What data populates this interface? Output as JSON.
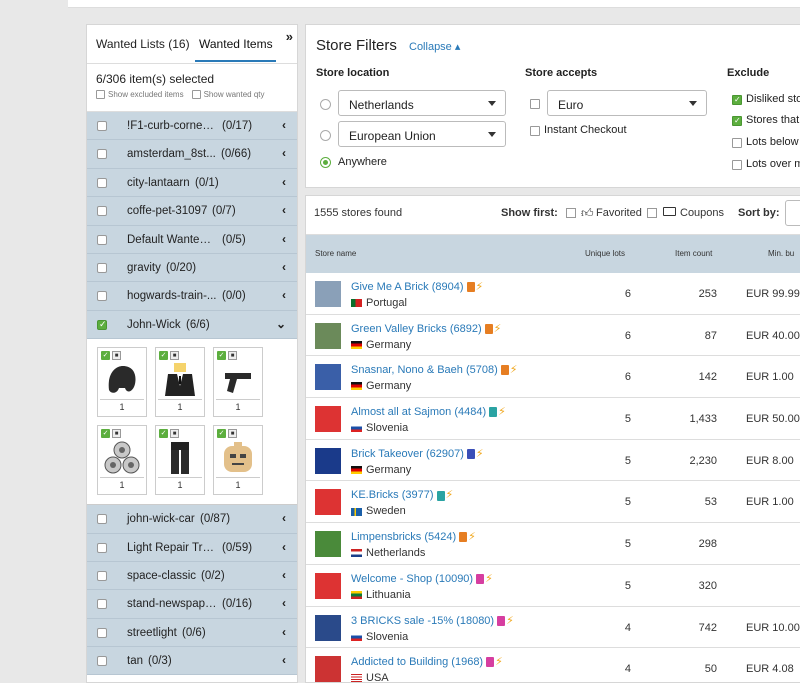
{
  "left_panel": {
    "tab_wanted_lists": "Wanted Lists (16)",
    "tab_wanted_items": "Wanted Items",
    "selected_info": "6/306 item(s) selected",
    "show_excluded": "Show excluded items",
    "show_wanted_qty": "Show wanted qty",
    "lists_top": [
      {
        "name": "!F1-curb-corner-1...",
        "count": "(0/17)",
        "checked": false
      },
      {
        "name": "amsterdam_8st...",
        "count": "(0/66)",
        "checked": false
      },
      {
        "name": "city-lantaarn",
        "count": "(0/1)",
        "checked": false
      },
      {
        "name": "coffe-pet-31097",
        "count": "(0/7)",
        "checked": false
      },
      {
        "name": "Default Wanted ...",
        "count": "(0/5)",
        "checked": false
      },
      {
        "name": "gravity",
        "count": "(0/20)",
        "checked": false
      },
      {
        "name": "hogwards-train-...",
        "count": "(0/0)",
        "checked": false
      },
      {
        "name": "John-Wick",
        "count": "(6/6)",
        "checked": true
      }
    ],
    "items": [
      {
        "icon": "hair-piece",
        "qty": "1"
      },
      {
        "icon": "suit-torso",
        "qty": "1"
      },
      {
        "icon": "pistol",
        "qty": "1"
      },
      {
        "icon": "coin-tokens",
        "qty": "1"
      },
      {
        "icon": "black-legs",
        "qty": "1"
      },
      {
        "icon": "minifig-head",
        "qty": "1"
      }
    ],
    "lists_bottom": [
      {
        "name": "john-wick-car",
        "count": "(0/87)",
        "checked": false
      },
      {
        "name": "Light Repair Truck",
        "count": "(0/59)",
        "checked": false
      },
      {
        "name": "space-classic",
        "count": "(0/2)",
        "checked": false
      },
      {
        "name": "stand-newspape...",
        "count": "(0/16)",
        "checked": false
      },
      {
        "name": "streetlight",
        "count": "(0/6)",
        "checked": false
      },
      {
        "name": "tan",
        "count": "(0/3)",
        "checked": false
      }
    ]
  },
  "filters": {
    "title": "Store Filters",
    "collapse": "Collapse",
    "location_label": "Store location",
    "location_select_1": "Netherlands",
    "location_select_2": "European Union",
    "anywhere": "Anywhere",
    "accepts_label": "Store accepts",
    "currency": "Euro",
    "instant_checkout": "Instant Checkout",
    "exclude_label": "Exclude",
    "exclude": [
      "Disliked sto",
      "Stores that",
      "Lots below",
      "Lots over m"
    ]
  },
  "results": {
    "found": "1555 stores found",
    "show_first": "Show first:",
    "favorited": "Favorited",
    "coupons": "Coupons",
    "sort_by": "Sort by:",
    "col_store": "Store name",
    "col_lots": "Unique lots",
    "col_count": "Item count",
    "col_min": "Min. bu",
    "stores": [
      {
        "name": "Give Me A Brick",
        "id": "(8904)",
        "ckbolt": "ϟ",
        "country": "Portugal",
        "flag": "portugal",
        "lots": "6",
        "count": "253",
        "min": "EUR 99.99",
        "logo": "#8aa0b8"
      },
      {
        "name": "Green Valley Bricks",
        "id": "(6892)",
        "ckbolt": "",
        "country": "Germany",
        "flag": "germany",
        "lots": "6",
        "count": "87",
        "min": "EUR 40.00",
        "logo": "#6b8a5a"
      },
      {
        "name": "Snasnar, Nono & Baeh",
        "id": "(5708)",
        "ckbolt": "",
        "country": "Germany",
        "flag": "germany",
        "lots": "6",
        "count": "142",
        "min": "EUR 1.00",
        "logo": "#3a5fa8"
      },
      {
        "name": "Almost all at Sajmon",
        "id": "(4484)",
        "ckbolt": "",
        "country": "Slovenia",
        "flag": "slovenia",
        "lots": "5",
        "count": "1,433",
        "min": "EUR 50.00",
        "logo": "#d33"
      },
      {
        "name": "Brick Takeover",
        "id": "(62907)",
        "ckbolt": "",
        "country": "Germany",
        "flag": "germany",
        "lots": "5",
        "count": "2,230",
        "min": "EUR 8.00",
        "logo": "#1a3a8a"
      },
      {
        "name": "KE.Bricks",
        "id": "(3977)",
        "ckbolt": "",
        "country": "Sweden",
        "flag": "sweden",
        "lots": "5",
        "count": "53",
        "min": "EUR 1.00",
        "logo": "#d33"
      },
      {
        "name": "Limpensbricks",
        "id": "(5424)",
        "ckbolt": "",
        "country": "Netherlands",
        "flag": "netherlands",
        "lots": "5",
        "count": "298",
        "min": "",
        "logo": "#4a8a3a"
      },
      {
        "name": "Welcome - Shop",
        "id": "(10090)",
        "ckbolt": "",
        "country": "Lithuania",
        "flag": "lithuania",
        "lots": "5",
        "count": "320",
        "min": "",
        "logo": "#d33"
      },
      {
        "name": "3 BRICKS sale -15%",
        "id": "(18080)",
        "ckbolt": "",
        "country": "Slovenia",
        "flag": "slovenia",
        "lots": "4",
        "count": "742",
        "min": "EUR 10.00",
        "logo": "#2a4a8a"
      },
      {
        "name": "Addicted to Building",
        "id": "(1968)",
        "ckbolt": "",
        "country": "USA",
        "flag": "usa",
        "lots": "4",
        "count": "50",
        "min": "EUR 4.08",
        "logo": "#c33"
      }
    ]
  },
  "colors": {
    "accent": "#2a7ab8",
    "check_green": "#5cae3e",
    "row_blue": "#c8d6e0",
    "bolt": "#f0a820"
  }
}
